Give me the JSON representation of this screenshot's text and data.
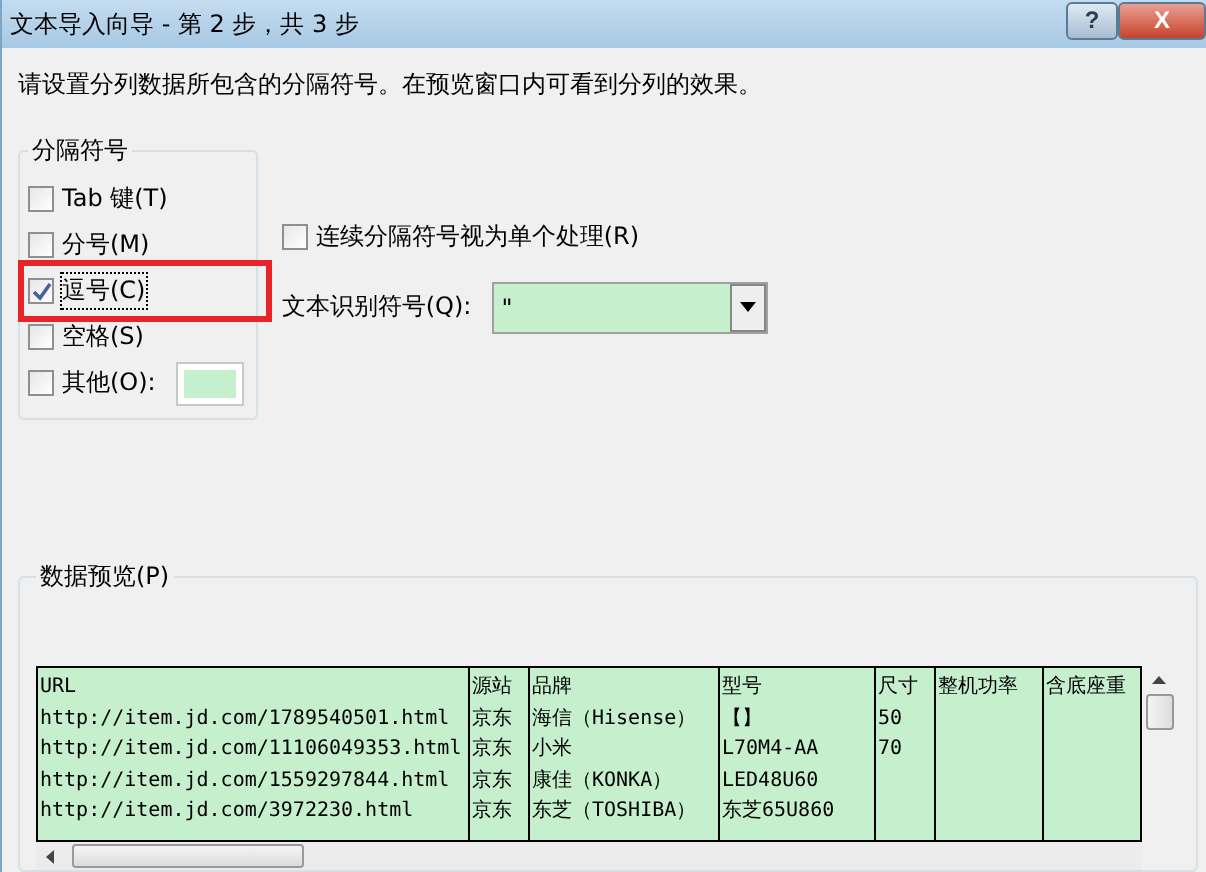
{
  "window": {
    "title": "文本导入向导 - 第 2 步，共 3 步",
    "buttons": [
      "?",
      "X"
    ]
  },
  "instruction": "请设置分列数据所包含的分隔符号。在预览窗口内可看到分列的效果。",
  "delimiters": {
    "title": "分隔符号",
    "items": [
      {
        "label": "Tab 键(T)",
        "checked": false,
        "highlighted": false,
        "has_field": false
      },
      {
        "label": "分号(M)",
        "checked": false,
        "highlighted": false,
        "has_field": false
      },
      {
        "label": "逗号(C)",
        "checked": true,
        "highlighted": true,
        "has_field": false
      },
      {
        "label": "空格(S)",
        "checked": false,
        "highlighted": false,
        "has_field": false
      },
      {
        "label": "其他(O):",
        "checked": false,
        "highlighted": false,
        "has_field": true
      }
    ]
  },
  "consecutive": {
    "label": "连续分隔符号视为单个处理(R)",
    "checked": false
  },
  "qualifier": {
    "label": "文本识别符号(Q):",
    "value": "\""
  },
  "preview": {
    "title": "数据预览(P)",
    "rows": [
      [
        "URL",
        "源站",
        "品牌",
        "型号",
        "尺寸",
        "整机功率",
        "含底座重"
      ],
      [
        "http://item.jd.com/1789540501.html",
        "京东",
        "海信（Hisense）",
        "【】",
        "50",
        null,
        null
      ],
      [
        "http://item.jd.com/11106049353.html",
        "京东",
        "小米",
        "L70M4-AA",
        "70",
        null,
        null
      ],
      [
        "http://item.jd.com/1559297844.html",
        "京东",
        "康佳（KONKA）",
        "LED48U60",
        null,
        null,
        null
      ],
      [
        "http://item.jd.com/3972230.html",
        "京东",
        "东芝（TOSHIBA）",
        "东芝65U860",
        null,
        null,
        null
      ]
    ]
  }
}
